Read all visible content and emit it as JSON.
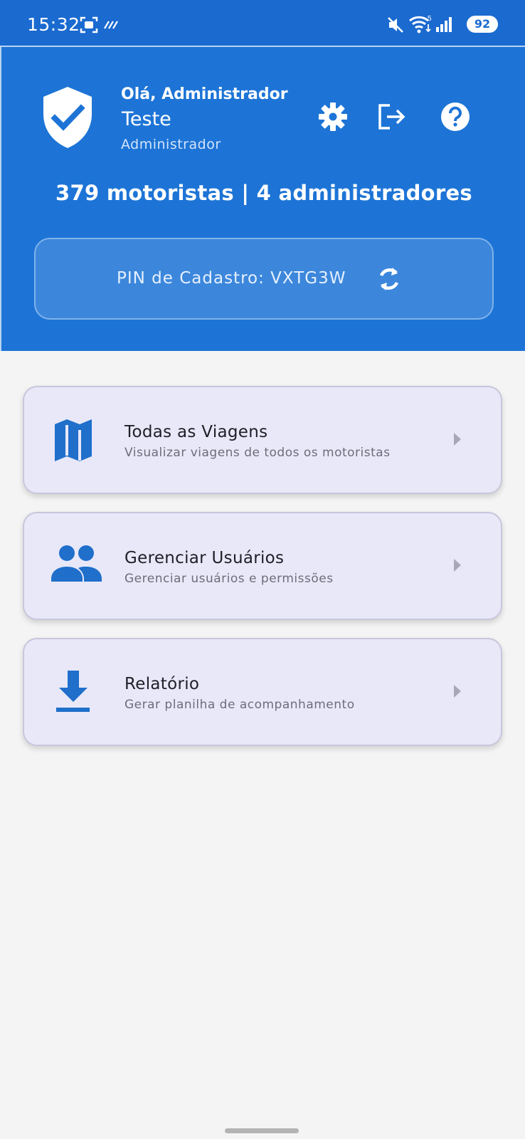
{
  "status_bar": {
    "time": "15:32",
    "battery": "92",
    "icons": [
      "screenshot-icon",
      "data-saver-icon",
      "mute-icon",
      "wifi-icon",
      "signal-icon",
      "battery-icon"
    ]
  },
  "header": {
    "greeting": "Olá, Administrador",
    "username": "Teste",
    "role": "Administrador",
    "stats": "379 motoristas  | 4 administradores",
    "pin_text": "PIN de Cadastro: VXTG3W",
    "icons": [
      "shield-check-icon",
      "gear-icon",
      "logout-icon",
      "help-icon",
      "refresh-icon"
    ]
  },
  "menu": {
    "items": [
      {
        "title": "Todas as Viagens",
        "subtitle": "Visualizar viagens de todos os motoristas",
        "icon": "map-icon"
      },
      {
        "title": "Gerenciar Usuários",
        "subtitle": "Gerenciar usuários e permissões",
        "icon": "users-icon"
      },
      {
        "title": "Relatório",
        "subtitle": "Gerar planilha de acompanhamento",
        "icon": "download-icon"
      }
    ]
  },
  "colors": {
    "primary": "#1d74d6",
    "status_bar": "#1a6ad0",
    "card_bg": "#e8e8f8",
    "icon_blue": "#1f6fcb",
    "background": "#f4f4f4"
  }
}
